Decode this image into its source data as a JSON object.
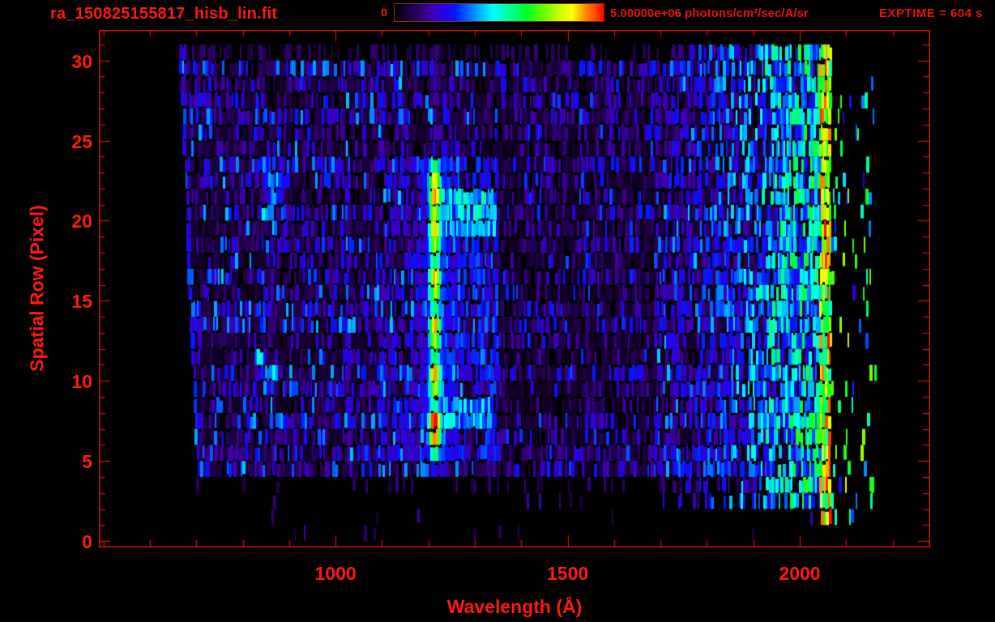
{
  "header": {
    "title": "ra_150825155817_hisb_lin.fit",
    "exptime_label": "EXPTIME = 604 s",
    "colorbar": {
      "min_label": "0",
      "max_label": "5.00000e+06 photons/cm²/sec/A/sr"
    }
  },
  "style": {
    "background": "#000000",
    "annotation_color": "#ff1a0d",
    "annotation_color_dim": "#e51505",
    "frame_color": "#d41400",
    "colorbar_border": "#8f2712"
  },
  "chart_data": {
    "type": "heatmap",
    "title": "ra_150825155817_hisb_lin.fit",
    "xlabel": "Wavelength (Å)",
    "ylabel": "Spatial Row (Pixel)",
    "xlim": [
      490,
      2281
    ],
    "ylim": [
      -0.4,
      31.9
    ],
    "x_major_ticks": [
      1000,
      1500,
      2000
    ],
    "x_minor_step": 100,
    "x_minor_range": [
      500,
      2200
    ],
    "y_major_ticks": [
      0,
      5,
      10,
      15,
      20,
      25,
      30
    ],
    "y_minor_step": 1,
    "colorbar": {
      "min": 0,
      "max": 5000000,
      "min_label": "0",
      "max_label": "5.00000e+06",
      "units": "photons/cm²/sec/A/sr"
    },
    "exptime_seconds": 604,
    "legend_position": "top",
    "grid": false,
    "notable_features": [
      "Bright Lyman-alpha emission column near 1216 A spanning spatial rows 5-24, green/yellow/orange core with blue-cyan halo",
      "Cyan emission blobs near 820-900 A at rows 10-12 and 19-23",
      "Faint Lyman-beta column near 1026 A, rows 5-24",
      "Faint slanted blue column at detector left edge near 665-710 A",
      "Rising solar reflected continuum speckle from ~1700 A, saturated multicolor edge column near 2045-2070 A",
      "Sparse noise dots below row 4; dark violet/blue background noise rows 4-30"
    ],
    "colormap_stops": [
      [
        0.0,
        "#000000"
      ],
      [
        0.05,
        "#14002e"
      ],
      [
        0.11,
        "#2a0060"
      ],
      [
        0.17,
        "#4000a8"
      ],
      [
        0.23,
        "#2a00e6"
      ],
      [
        0.29,
        "#0018ff"
      ],
      [
        0.35,
        "#0064ff"
      ],
      [
        0.41,
        "#00b4ff"
      ],
      [
        0.47,
        "#00ffff"
      ],
      [
        0.55,
        "#00ff96"
      ],
      [
        0.63,
        "#00ff28"
      ],
      [
        0.71,
        "#64ff00"
      ],
      [
        0.79,
        "#c8ff00"
      ],
      [
        0.85,
        "#ffff00"
      ],
      [
        0.91,
        "#ff9100"
      ],
      [
        0.96,
        "#ff4800"
      ],
      [
        1.0,
        "#ff0000"
      ]
    ],
    "render_model": {
      "seed": 150825155,
      "data_lambda_min": 663,
      "data_lambda_max": 2170,
      "bg_lambda_hi": 2066,
      "edge_slant_per_row": 1.5,
      "noise": {
        "base": 0.05,
        "range": 0.27,
        "power": 2.6,
        "speckle_prob": 0.05,
        "speckle_value": 0.33,
        "gap_prob": 0.08,
        "mid_dim_lo": 1350,
        "mid_dim_hi": 1690,
        "mid_dim_factor": 0.8
      },
      "rows": {
        "full_lo": 4,
        "full_hi": 29,
        "dim_row": 30,
        "dim_prob": 0.45,
        "sparse_row": 3,
        "sparse_prob": 0.18,
        "bottom_prob": 0.035
      },
      "lyman_alpha": {
        "center": 1214,
        "sigma": 16,
        "amp": 0.74,
        "row_lo": 5,
        "row_hi": 23,
        "hot_rows": [
          6,
          7,
          20,
          21
        ],
        "hot_boost": 0.18,
        "halo_center": 1220,
        "halo_sigma": 45,
        "halo_amp": 0.32,
        "faint_top_amp": 0.14,
        "below_row4_factor": 0.3
      },
      "lyman_beta": {
        "center": 1026,
        "sigma": 6,
        "amp": 0.2,
        "row_lo": 5,
        "row_hi": 23
      },
      "cyan_streaks": [
        [
          7,
          8,
          1230,
          1335,
          0.4
        ],
        [
          19,
          21,
          1230,
          1345,
          0.42
        ]
      ],
      "blue_bands": [
        {
          "lambda_lo": 1228,
          "lambda_hi": 1350,
          "row_lo": 5,
          "row_hi": 23,
          "prob": 0.55,
          "val_lo": 0.16,
          "val_hi": 0.34
        },
        {
          "lambda_lo": 1090,
          "lambda_hi": 1198,
          "row_lo": 5,
          "row_hi": 23,
          "prob": 0.45,
          "val_lo": 0.14,
          "val_hi": 0.3
        }
      ],
      "blobs": [
        {
          "lambda": 868,
          "row": 22.2,
          "sig_l": 22,
          "sig_r": 1.1,
          "amp": 0.46
        },
        {
          "lambda": 846,
          "row": 20.6,
          "sig_l": 11,
          "sig_r": 0.9,
          "amp": 0.44
        },
        {
          "lambda": 890,
          "row": 20.2,
          "sig_l": 10,
          "sig_r": 0.9,
          "amp": 0.38
        },
        {
          "lambda": 836,
          "row": 11.2,
          "sig_l": 13,
          "sig_r": 0.9,
          "amp": 0.5
        },
        {
          "lambda": 864,
          "row": 10.4,
          "sig_l": 15,
          "sig_r": 0.8,
          "amp": 0.46
        },
        {
          "lambda": 672,
          "row": 29.6,
          "sig_l": 9,
          "sig_r": 1.2,
          "amp": 0.34
        }
      ],
      "left_column": {
        "lambda_top": 668,
        "slant_per_row": 1.3,
        "halfwidth": 5,
        "value": 0.24,
        "row_lo": 4,
        "row_hi": 30
      },
      "solar": {
        "lambda_lo": 1690,
        "lambda_hi": 2045,
        "prob_lo": 0.22,
        "prob_hi": 0.85,
        "val_lo": 0.16,
        "val_hi": 0.52,
        "row_lo": 2,
        "row_hi": 30
      },
      "bright_edge": {
        "lambda_lo": 2044,
        "lambda_hi": 2068,
        "val_lo": 0.5,
        "val_hi": 1.0,
        "row_lo": 1,
        "row_hi": 30
      },
      "tail": {
        "lambda_lo": 2068,
        "lambda_hi": 2170,
        "prob": 0.12,
        "val_lo": 0.2,
        "val_hi": 0.8,
        "row_lo": 1,
        "row_hi": 29
      }
    }
  }
}
